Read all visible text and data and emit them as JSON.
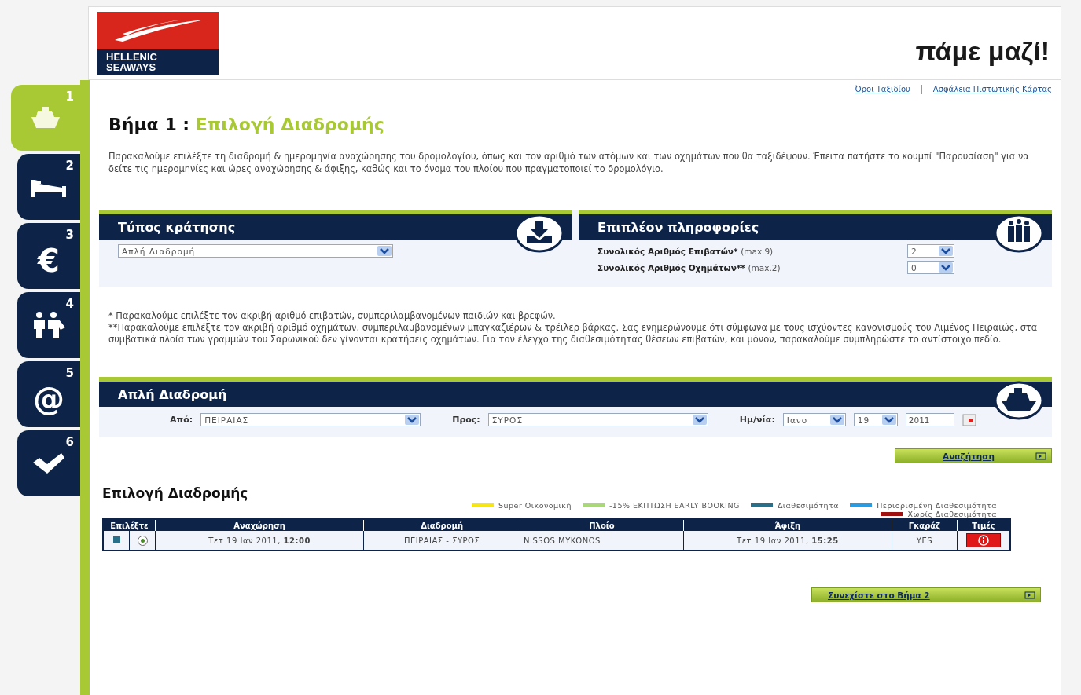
{
  "header": {
    "logo_line1": "HELLENIC",
    "logo_line2": "SEAWAYS",
    "slogan": "πάμε μαζί!"
  },
  "steps": [
    {
      "number": "1",
      "kind": "ship",
      "selected": true
    },
    {
      "number": "2",
      "kind": "bed",
      "selected": false
    },
    {
      "number": "3",
      "kind": "glyph",
      "glyph": "€",
      "selected": false
    },
    {
      "number": "4",
      "kind": "people",
      "selected": false
    },
    {
      "number": "5",
      "kind": "glyph",
      "glyph": "@",
      "selected": false
    },
    {
      "number": "6",
      "kind": "check",
      "selected": false
    }
  ],
  "top_links": [
    "Όροι Ταξιδίου",
    "Ασφάλεια Πιστωτικής Κάρτας"
  ],
  "title": {
    "step": "Βήμα 1 :",
    "name": "Επιλογή Διαδρομής"
  },
  "intro": "Παρακαλούμε επιλέξτε τη διαδρομή & ημερομηνία αναχώρησης του δρομολογίου, όπως και τον αριθμό των ατόμων και των οχημάτων που θα ταξιδέψουν. Έπειτα πατήστε το κουμπί \"Παρουσίαση\" για να δείτε τις ημερομηνίες και ώρες αναχώρησης & άφιξης, καθώς και το όνομα του πλοίου που πραγματοποιεί το δρομολόγιο.",
  "booking_type": {
    "title": "Τύπος κράτησης",
    "value": "Απλή Διαδρομή"
  },
  "more_info": {
    "title": "Επιπλέον πληροφορίες",
    "fields": [
      {
        "label": "Συνολικός Αριθμός Επιβατών*",
        "hint": "(max.9)",
        "value": "2"
      },
      {
        "label": "Συνολικός Αριθμός Οχημάτων**",
        "hint": "(max.2)",
        "value": "0"
      }
    ]
  },
  "notes": [
    "* Παρακαλούμε επιλέξτε τον ακριβή αριθμό επιβατών, συμπεριλαμβανομένων παιδιών και βρεφών.",
    "**Παρακαλούμε επιλέξτε τον ακριβή αριθμό οχημάτων, συμπεριλαμβανομένων μπαγκαζιέρων & τρέιλερ βάρκας. Σας ενημερώνουμε ότι σύμφωνα με τους ισχύοντες κανονισμούς του Λιμένος Πειραιώς, στα συμβατικά πλοία των γραμμών του Σαρωνικού δεν γίνονται κρατήσεις οχημάτων. Για τον έλεγχο της διαθεσιμότητας θέσεων επιβατών, και μόνον, παρακαλούμε συμπληρώστε το αντίστοιχο πεδίο."
  ],
  "route": {
    "title": "Απλή Διαδρομή",
    "from_label": "Από:",
    "from": "ΠΕΙΡΑΙΑΣ",
    "to_label": "Προς:",
    "to": "ΣΥΡΟΣ",
    "date_label": "Ημ/νία:",
    "month": "Ιανο",
    "day": "19",
    "year": "2011",
    "search_button": "Αναζήτηση"
  },
  "results": {
    "title": "Επιλογή Διαδρομής",
    "legend": [
      {
        "label": "Super Οικονομική",
        "color": "#f5e614"
      },
      {
        "label": "-15% ΕΚΠΤΩΣΗ EARLY BOOKING",
        "color": "#a8d878"
      },
      {
        "label": "Διαθεσιμότητα",
        "color": "#2a6f8a"
      },
      {
        "label": "Περιορισμένη Διαθεσιμότητα",
        "color": "#2a9be0"
      },
      {
        "label": "Χωρίς Διαθεσιμότητα",
        "color": "#a01010"
      }
    ],
    "columns": [
      "Επιλέξτε",
      "Αναχώρηση",
      "Διαδρομή",
      "Πλοίο",
      "Άφιξη",
      "Γκαράζ",
      "Τιμές"
    ],
    "rows": [
      {
        "color": "#2a6f8a",
        "selected": true,
        "departure": "Τετ 19 Ιαν 2011, **12:00**",
        "route": "ΠΕΙΡΑΙΑΣ - ΣΥΡΟΣ",
        "ship": "NISSOS MYKONOS",
        "arrival": "Τετ 19 Ιαν 2011, **15:25**",
        "garage": "YES"
      }
    ]
  },
  "continue_button": "Συνεχίστε στο Βήμα 2"
}
